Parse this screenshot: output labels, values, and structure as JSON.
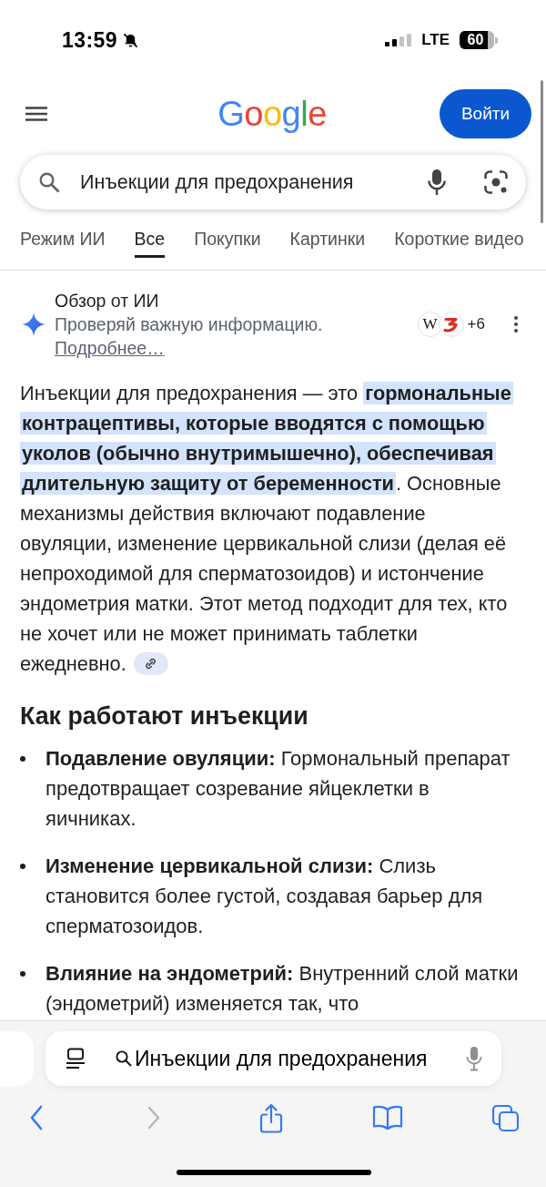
{
  "status_bar": {
    "time": "13:59",
    "network": "LTE",
    "battery": "60"
  },
  "header": {
    "logo": "Google",
    "sign_in": "Войти"
  },
  "search": {
    "value": "Инъекции для предохранения"
  },
  "tabs": [
    {
      "label": "Режим ИИ",
      "selected": false
    },
    {
      "label": "Все",
      "selected": true
    },
    {
      "label": "Покупки",
      "selected": false
    },
    {
      "label": "Картинки",
      "selected": false
    },
    {
      "label": "Короткие видео",
      "selected": false
    }
  ],
  "ai_overview": {
    "title": "Обзор от ИИ",
    "notice": "Проверяй важную информацию.",
    "learn_more": "Подробнее…",
    "sources": [
      {
        "kind": "letter",
        "text": "W"
      },
      {
        "kind": "swoosh"
      }
    ],
    "more_sources": "+6",
    "summary": "Инъекции для предохранения — это **гормональные контрацептивы, которые вводятся с помощью уколов (обычно внутримышечно), обеспечивая длительную защиту от беременности**. Основные механизмы действия включают подавление овуляции, изменение цервикальной слизи (делая её непроходимой для сперматозоидов) и истончение эндометрия матки. Этот метод подходит для тех, кто не хочет или не может принимать таблетки ежедневно.",
    "section_title": "Как работают инъекции",
    "points": [
      "**Подавление овуляции:** Гормональный препарат предотвращает созревание яйцеклетки в яичниках.",
      "**Изменение цервикальной слизи:** Слизь становится более густой, создавая барьер для сперматозоидов.",
      "**Влияние на эндометрий:** Внутренний слой матки (эндометрий) изменяется так, что"
    ]
  },
  "browser_bar": {
    "address": "Инъекции для предохранения"
  }
}
